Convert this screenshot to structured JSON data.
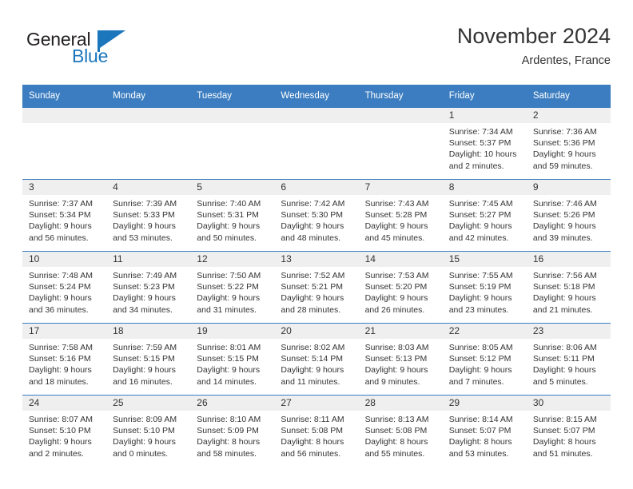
{
  "logo": {
    "word_one": "General",
    "word_two": "Blue",
    "icon": "flag-triangle-icon"
  },
  "header": {
    "title": "November 2024",
    "subtitle": "Ardentes, France"
  },
  "colors": {
    "header_blue": "#3b7dc0",
    "logo_blue": "#1b76bc",
    "daynum_band": "#efefef",
    "text": "#333333"
  },
  "calendar": {
    "weekday_headers": [
      "Sunday",
      "Monday",
      "Tuesday",
      "Wednesday",
      "Thursday",
      "Friday",
      "Saturday"
    ],
    "weeks": [
      [
        {
          "day": "",
          "sunrise": "",
          "sunset": "",
          "daylight_line1": "",
          "daylight_line2": ""
        },
        {
          "day": "",
          "sunrise": "",
          "sunset": "",
          "daylight_line1": "",
          "daylight_line2": ""
        },
        {
          "day": "",
          "sunrise": "",
          "sunset": "",
          "daylight_line1": "",
          "daylight_line2": ""
        },
        {
          "day": "",
          "sunrise": "",
          "sunset": "",
          "daylight_line1": "",
          "daylight_line2": ""
        },
        {
          "day": "",
          "sunrise": "",
          "sunset": "",
          "daylight_line1": "",
          "daylight_line2": ""
        },
        {
          "day": "1",
          "sunrise": "Sunrise: 7:34 AM",
          "sunset": "Sunset: 5:37 PM",
          "daylight_line1": "Daylight: 10 hours",
          "daylight_line2": "and 2 minutes."
        },
        {
          "day": "2",
          "sunrise": "Sunrise: 7:36 AM",
          "sunset": "Sunset: 5:36 PM",
          "daylight_line1": "Daylight: 9 hours",
          "daylight_line2": "and 59 minutes."
        }
      ],
      [
        {
          "day": "3",
          "sunrise": "Sunrise: 7:37 AM",
          "sunset": "Sunset: 5:34 PM",
          "daylight_line1": "Daylight: 9 hours",
          "daylight_line2": "and 56 minutes."
        },
        {
          "day": "4",
          "sunrise": "Sunrise: 7:39 AM",
          "sunset": "Sunset: 5:33 PM",
          "daylight_line1": "Daylight: 9 hours",
          "daylight_line2": "and 53 minutes."
        },
        {
          "day": "5",
          "sunrise": "Sunrise: 7:40 AM",
          "sunset": "Sunset: 5:31 PM",
          "daylight_line1": "Daylight: 9 hours",
          "daylight_line2": "and 50 minutes."
        },
        {
          "day": "6",
          "sunrise": "Sunrise: 7:42 AM",
          "sunset": "Sunset: 5:30 PM",
          "daylight_line1": "Daylight: 9 hours",
          "daylight_line2": "and 48 minutes."
        },
        {
          "day": "7",
          "sunrise": "Sunrise: 7:43 AM",
          "sunset": "Sunset: 5:28 PM",
          "daylight_line1": "Daylight: 9 hours",
          "daylight_line2": "and 45 minutes."
        },
        {
          "day": "8",
          "sunrise": "Sunrise: 7:45 AM",
          "sunset": "Sunset: 5:27 PM",
          "daylight_line1": "Daylight: 9 hours",
          "daylight_line2": "and 42 minutes."
        },
        {
          "day": "9",
          "sunrise": "Sunrise: 7:46 AM",
          "sunset": "Sunset: 5:26 PM",
          "daylight_line1": "Daylight: 9 hours",
          "daylight_line2": "and 39 minutes."
        }
      ],
      [
        {
          "day": "10",
          "sunrise": "Sunrise: 7:48 AM",
          "sunset": "Sunset: 5:24 PM",
          "daylight_line1": "Daylight: 9 hours",
          "daylight_line2": "and 36 minutes."
        },
        {
          "day": "11",
          "sunrise": "Sunrise: 7:49 AM",
          "sunset": "Sunset: 5:23 PM",
          "daylight_line1": "Daylight: 9 hours",
          "daylight_line2": "and 34 minutes."
        },
        {
          "day": "12",
          "sunrise": "Sunrise: 7:50 AM",
          "sunset": "Sunset: 5:22 PM",
          "daylight_line1": "Daylight: 9 hours",
          "daylight_line2": "and 31 minutes."
        },
        {
          "day": "13",
          "sunrise": "Sunrise: 7:52 AM",
          "sunset": "Sunset: 5:21 PM",
          "daylight_line1": "Daylight: 9 hours",
          "daylight_line2": "and 28 minutes."
        },
        {
          "day": "14",
          "sunrise": "Sunrise: 7:53 AM",
          "sunset": "Sunset: 5:20 PM",
          "daylight_line1": "Daylight: 9 hours",
          "daylight_line2": "and 26 minutes."
        },
        {
          "day": "15",
          "sunrise": "Sunrise: 7:55 AM",
          "sunset": "Sunset: 5:19 PM",
          "daylight_line1": "Daylight: 9 hours",
          "daylight_line2": "and 23 minutes."
        },
        {
          "day": "16",
          "sunrise": "Sunrise: 7:56 AM",
          "sunset": "Sunset: 5:18 PM",
          "daylight_line1": "Daylight: 9 hours",
          "daylight_line2": "and 21 minutes."
        }
      ],
      [
        {
          "day": "17",
          "sunrise": "Sunrise: 7:58 AM",
          "sunset": "Sunset: 5:16 PM",
          "daylight_line1": "Daylight: 9 hours",
          "daylight_line2": "and 18 minutes."
        },
        {
          "day": "18",
          "sunrise": "Sunrise: 7:59 AM",
          "sunset": "Sunset: 5:15 PM",
          "daylight_line1": "Daylight: 9 hours",
          "daylight_line2": "and 16 minutes."
        },
        {
          "day": "19",
          "sunrise": "Sunrise: 8:01 AM",
          "sunset": "Sunset: 5:15 PM",
          "daylight_line1": "Daylight: 9 hours",
          "daylight_line2": "and 14 minutes."
        },
        {
          "day": "20",
          "sunrise": "Sunrise: 8:02 AM",
          "sunset": "Sunset: 5:14 PM",
          "daylight_line1": "Daylight: 9 hours",
          "daylight_line2": "and 11 minutes."
        },
        {
          "day": "21",
          "sunrise": "Sunrise: 8:03 AM",
          "sunset": "Sunset: 5:13 PM",
          "daylight_line1": "Daylight: 9 hours",
          "daylight_line2": "and 9 minutes."
        },
        {
          "day": "22",
          "sunrise": "Sunrise: 8:05 AM",
          "sunset": "Sunset: 5:12 PM",
          "daylight_line1": "Daylight: 9 hours",
          "daylight_line2": "and 7 minutes."
        },
        {
          "day": "23",
          "sunrise": "Sunrise: 8:06 AM",
          "sunset": "Sunset: 5:11 PM",
          "daylight_line1": "Daylight: 9 hours",
          "daylight_line2": "and 5 minutes."
        }
      ],
      [
        {
          "day": "24",
          "sunrise": "Sunrise: 8:07 AM",
          "sunset": "Sunset: 5:10 PM",
          "daylight_line1": "Daylight: 9 hours",
          "daylight_line2": "and 2 minutes."
        },
        {
          "day": "25",
          "sunrise": "Sunrise: 8:09 AM",
          "sunset": "Sunset: 5:10 PM",
          "daylight_line1": "Daylight: 9 hours",
          "daylight_line2": "and 0 minutes."
        },
        {
          "day": "26",
          "sunrise": "Sunrise: 8:10 AM",
          "sunset": "Sunset: 5:09 PM",
          "daylight_line1": "Daylight: 8 hours",
          "daylight_line2": "and 58 minutes."
        },
        {
          "day": "27",
          "sunrise": "Sunrise: 8:11 AM",
          "sunset": "Sunset: 5:08 PM",
          "daylight_line1": "Daylight: 8 hours",
          "daylight_line2": "and 56 minutes."
        },
        {
          "day": "28",
          "sunrise": "Sunrise: 8:13 AM",
          "sunset": "Sunset: 5:08 PM",
          "daylight_line1": "Daylight: 8 hours",
          "daylight_line2": "and 55 minutes."
        },
        {
          "day": "29",
          "sunrise": "Sunrise: 8:14 AM",
          "sunset": "Sunset: 5:07 PM",
          "daylight_line1": "Daylight: 8 hours",
          "daylight_line2": "and 53 minutes."
        },
        {
          "day": "30",
          "sunrise": "Sunrise: 8:15 AM",
          "sunset": "Sunset: 5:07 PM",
          "daylight_line1": "Daylight: 8 hours",
          "daylight_line2": "and 51 minutes."
        }
      ]
    ]
  }
}
